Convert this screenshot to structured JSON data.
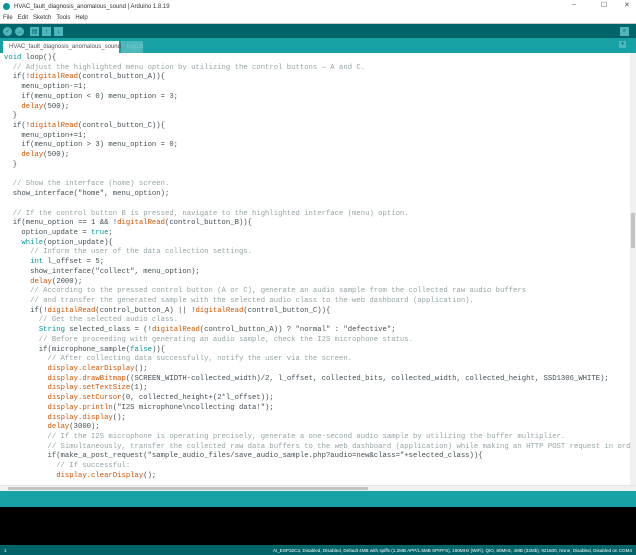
{
  "window": {
    "title": "HVAC_fault_diagnosis_anomalous_sound | Arduino 1.8.19",
    "minimize": "–",
    "maximize": "☐",
    "close": "✕"
  },
  "menu": [
    "File",
    "Edit",
    "Sketch",
    "Tools",
    "Help"
  ],
  "toolbar": {
    "verify": "✓",
    "upload": "→",
    "new": "▤",
    "open": "↑",
    "save": "↓",
    "serial_monitor": "⌕"
  },
  "tabs": [
    {
      "label": "HVAC_fault_diagnosis_anomalous_sound"
    },
    {
      "label": "logo.h"
    }
  ],
  "tab_menu": "▾",
  "code": [
    [
      [
        "k",
        "void"
      ],
      [
        "t",
        " loop(){"
      ]
    ],
    [
      [
        "c",
        "  // Adjust the highlighted menu option by utilizing the control buttons — A and C."
      ]
    ],
    [
      [
        "t",
        "  if(!"
      ],
      [
        "f",
        "digitalRead"
      ],
      [
        "t",
        "(control_button_A)){"
      ]
    ],
    [
      [
        "t",
        "    menu_option-=1;"
      ]
    ],
    [
      [
        "t",
        "    if(menu_option < 0) menu_option = 3;"
      ]
    ],
    [
      [
        "t",
        "    "
      ],
      [
        "f",
        "delay"
      ],
      [
        "t",
        "(500);"
      ]
    ],
    [
      [
        "t",
        "  }"
      ]
    ],
    [
      [
        "t",
        "  if(!"
      ],
      [
        "f",
        "digitalRead"
      ],
      [
        "t",
        "(control_button_C)){"
      ]
    ],
    [
      [
        "t",
        "    menu_option+=1;"
      ]
    ],
    [
      [
        "t",
        "    if(menu_option > 3) menu_option = 0;"
      ]
    ],
    [
      [
        "t",
        "    "
      ],
      [
        "f",
        "delay"
      ],
      [
        "t",
        "(500);"
      ]
    ],
    [
      [
        "t",
        "  }"
      ]
    ],
    [
      [
        "t",
        ""
      ]
    ],
    [
      [
        "c",
        "  // Show the interface (home) screen."
      ]
    ],
    [
      [
        "t",
        "  show_interface(\"home\", menu_option);"
      ]
    ],
    [
      [
        "t",
        ""
      ]
    ],
    [
      [
        "c",
        "  // If the control button B is pressed, navigate to the highlighted interface (menu) option."
      ]
    ],
    [
      [
        "t",
        "  if(menu_option == 1 && !"
      ],
      [
        "f",
        "digitalRead"
      ],
      [
        "t",
        "(control_button_B)){"
      ]
    ],
    [
      [
        "t",
        "    option_update = "
      ],
      [
        "k",
        "true"
      ],
      [
        "t",
        ";"
      ]
    ],
    [
      [
        "t",
        "    "
      ],
      [
        "k",
        "while"
      ],
      [
        "t",
        "(option_update){"
      ]
    ],
    [
      [
        "c",
        "      // Inform the user of the data collection settings."
      ]
    ],
    [
      [
        "t",
        "      "
      ],
      [
        "k",
        "int"
      ],
      [
        "t",
        " l_offset = 5;"
      ]
    ],
    [
      [
        "t",
        "      show_interface(\"collect\", menu_option);"
      ]
    ],
    [
      [
        "t",
        "      "
      ],
      [
        "f",
        "delay"
      ],
      [
        "t",
        "(2000);"
      ]
    ],
    [
      [
        "c",
        "      // According to the pressed control button (A or C), generate an audio sample from the collected raw audio buffers"
      ]
    ],
    [
      [
        "c",
        "      // and transfer the generated sample with the selected audio class to the web dashboard (application)."
      ]
    ],
    [
      [
        "t",
        "      if(!"
      ],
      [
        "f",
        "digitalRead"
      ],
      [
        "t",
        "(control_button_A) || !"
      ],
      [
        "f",
        "digitalRead"
      ],
      [
        "t",
        "(control_button_C)){"
      ]
    ],
    [
      [
        "c",
        "        // Get the selected audio class."
      ]
    ],
    [
      [
        "t",
        "        "
      ],
      [
        "k",
        "String"
      ],
      [
        "t",
        " selected_class = (!"
      ],
      [
        "f",
        "digitalRead"
      ],
      [
        "t",
        "(control_button_A)) ? \"normal\" : \"defective\";"
      ]
    ],
    [
      [
        "c",
        "        // Before proceeding with generating an audio sample, check the I2S microphone status."
      ]
    ],
    [
      [
        "t",
        "        if(microphone_sample("
      ],
      [
        "k",
        "false"
      ],
      [
        "t",
        ")){"
      ]
    ],
    [
      [
        "c",
        "          // After collecting data successfully, notify the user via the screen."
      ]
    ],
    [
      [
        "t",
        "          "
      ],
      [
        "f",
        "display.clearDisplay"
      ],
      [
        "t",
        "();"
      ]
    ],
    [
      [
        "t",
        "          "
      ],
      [
        "f",
        "display.drawBitmap"
      ],
      [
        "t",
        "((SCREEN_WIDTH-collected_width)/2, l_offset, collected_bits, collected_width, collected_height, SSD1306_WHITE);"
      ]
    ],
    [
      [
        "t",
        "          "
      ],
      [
        "f",
        "display.setTextSize"
      ],
      [
        "t",
        "(1);"
      ]
    ],
    [
      [
        "t",
        "          "
      ],
      [
        "f",
        "display.setCursor"
      ],
      [
        "t",
        "(0, collected_height+(2*l_offset));"
      ]
    ],
    [
      [
        "t",
        "          "
      ],
      [
        "f",
        "display.println"
      ],
      [
        "t",
        "(\"I2S microphone\\ncollecting data!\");"
      ]
    ],
    [
      [
        "t",
        "          "
      ],
      [
        "f",
        "display.display"
      ],
      [
        "t",
        "();"
      ]
    ],
    [
      [
        "t",
        "          "
      ],
      [
        "f",
        "delay"
      ],
      [
        "t",
        "(3000);"
      ]
    ],
    [
      [
        "c",
        "          // If the I2S microphone is operating precisely, generate a one-second audio sample by utilizing the buffer multiplier."
      ]
    ],
    [
      [
        "c",
        "          // Simultaneously, transfer the collected raw data buffers to the web dashboard (application) while making an HTTP POST request in order"
      ]
    ],
    [
      [
        "t",
        "          if(make_a_post_request(\"sample_audio_files/save_audio_sample.php?audio=new&class=\"+selected_class)){"
      ]
    ],
    [
      [
        "c",
        "            // If successful:"
      ]
    ],
    [
      [
        "t",
        "            "
      ],
      [
        "f",
        "display.clearDisplay"
      ],
      [
        "t",
        "();"
      ]
    ]
  ],
  "status": {
    "line": "1",
    "board": "AI_ESP32C3, Disabled, Disabled, Default 4MB with spiffs (1.2MB APP/1.5MB SPIFFS), 160MHz (WiFi), QIO, 80MHz, 4MB (32Mb), 921600, None, Disabled, Disabled on COM4"
  }
}
